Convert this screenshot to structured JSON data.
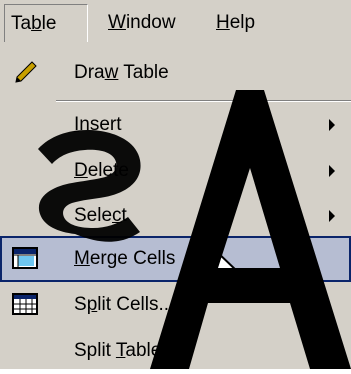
{
  "menubar": {
    "items": [
      {
        "label_pre": "Ta",
        "label_ul": "b",
        "label_post": "le"
      },
      {
        "label_pre": "",
        "label_ul": "W",
        "label_post": "indow"
      },
      {
        "label_pre": "",
        "label_ul": "H",
        "label_post": "elp"
      }
    ]
  },
  "menu": {
    "items": [
      {
        "label_pre": "Dra",
        "label_ul": "w",
        "label_post": " Table",
        "icon": "pencil-icon",
        "submenu": false
      },
      {
        "label_pre": "",
        "label_ul": "I",
        "label_post": "nsert",
        "icon": "",
        "submenu": true
      },
      {
        "label_pre": "",
        "label_ul": "D",
        "label_post": "elete",
        "icon": "",
        "submenu": true
      },
      {
        "label_pre": "Sele",
        "label_ul": "c",
        "label_post": "t",
        "icon": "",
        "submenu": true
      },
      {
        "label_pre": "",
        "label_ul": "M",
        "label_post": "erge Cells",
        "icon": "merge-cells-icon",
        "submenu": false,
        "highlighted": true
      },
      {
        "label_pre": "S",
        "label_ul": "p",
        "label_post": "lit Cells...",
        "icon": "split-cells-icon",
        "submenu": false
      },
      {
        "label_pre": "Split ",
        "label_ul": "T",
        "label_post": "able",
        "icon": "",
        "submenu": false
      }
    ]
  },
  "watermark": {
    "text": "SA"
  },
  "colors": {
    "menu_face": "#d4d0c8",
    "highlight_fill": "#b6bdd2",
    "highlight_border": "#0a246a",
    "watermark": "#000000"
  }
}
